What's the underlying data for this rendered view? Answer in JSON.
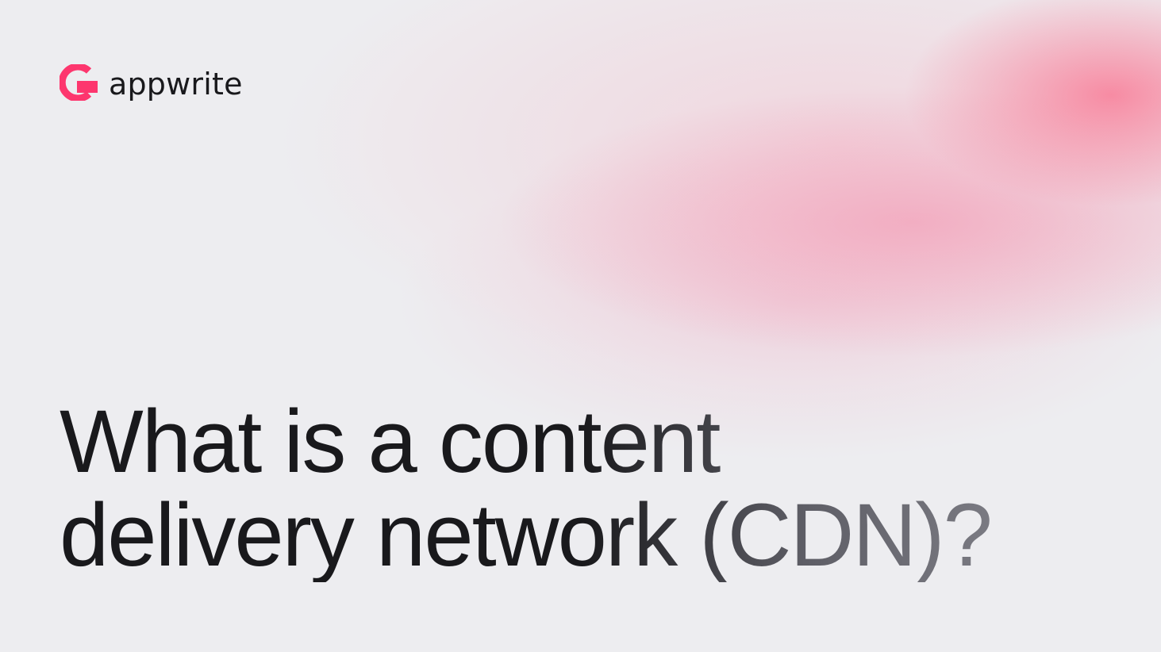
{
  "brand": {
    "name": "appwrite",
    "accent_color": "#fd366e",
    "logo_icon": "appwrite-logo-icon"
  },
  "headline": {
    "line1": "What is a content",
    "line2": "delivery network (CDN)?"
  },
  "colors": {
    "background": "#ededf0",
    "text": "#19191c",
    "glow": "#fa6e8c"
  }
}
